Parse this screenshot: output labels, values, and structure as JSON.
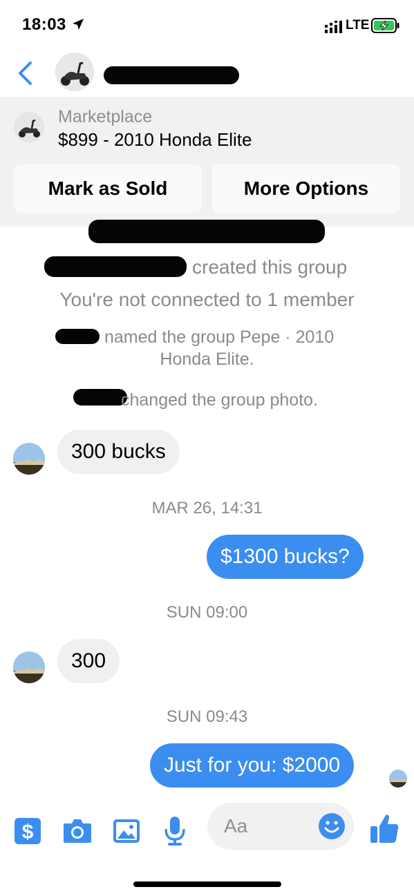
{
  "status_bar": {
    "time": "18:03",
    "network": "LTE"
  },
  "marketplace": {
    "label": "Marketplace",
    "title": "$899 - 2010 Honda Elite",
    "mark_sold_label": "Mark as Sold",
    "more_options_label": "More Options"
  },
  "system_messages": {
    "created": "created this group",
    "not_connected": "You're not connected to 1 member",
    "named_line1": "named the group Pepe · 2010",
    "named_line2": "Honda Elite.",
    "photo_changed": "changed the group photo."
  },
  "messages": [
    {
      "direction": "incoming",
      "text": "300 bucks"
    },
    {
      "timestamp": "MAR 26, 14:31"
    },
    {
      "direction": "outgoing",
      "text": "$1300 bucks?"
    },
    {
      "timestamp": "SUN 09:00"
    },
    {
      "direction": "incoming",
      "text": "300"
    },
    {
      "timestamp": "SUN 09:43"
    },
    {
      "direction": "outgoing",
      "text": "Just for you: $2000"
    }
  ],
  "composer": {
    "placeholder": "Aa"
  },
  "colors": {
    "accent": "#3b8ef0",
    "incoming_bubble": "#f0f0f0",
    "banner_bg": "#f1f1f2"
  },
  "icons": [
    "back-chevron-icon",
    "location-arrow-icon",
    "signal-icon",
    "battery-charging-icon",
    "dollar-icon",
    "camera-icon",
    "image-icon",
    "microphone-icon",
    "emoji-icon",
    "thumbs-up-icon"
  ]
}
